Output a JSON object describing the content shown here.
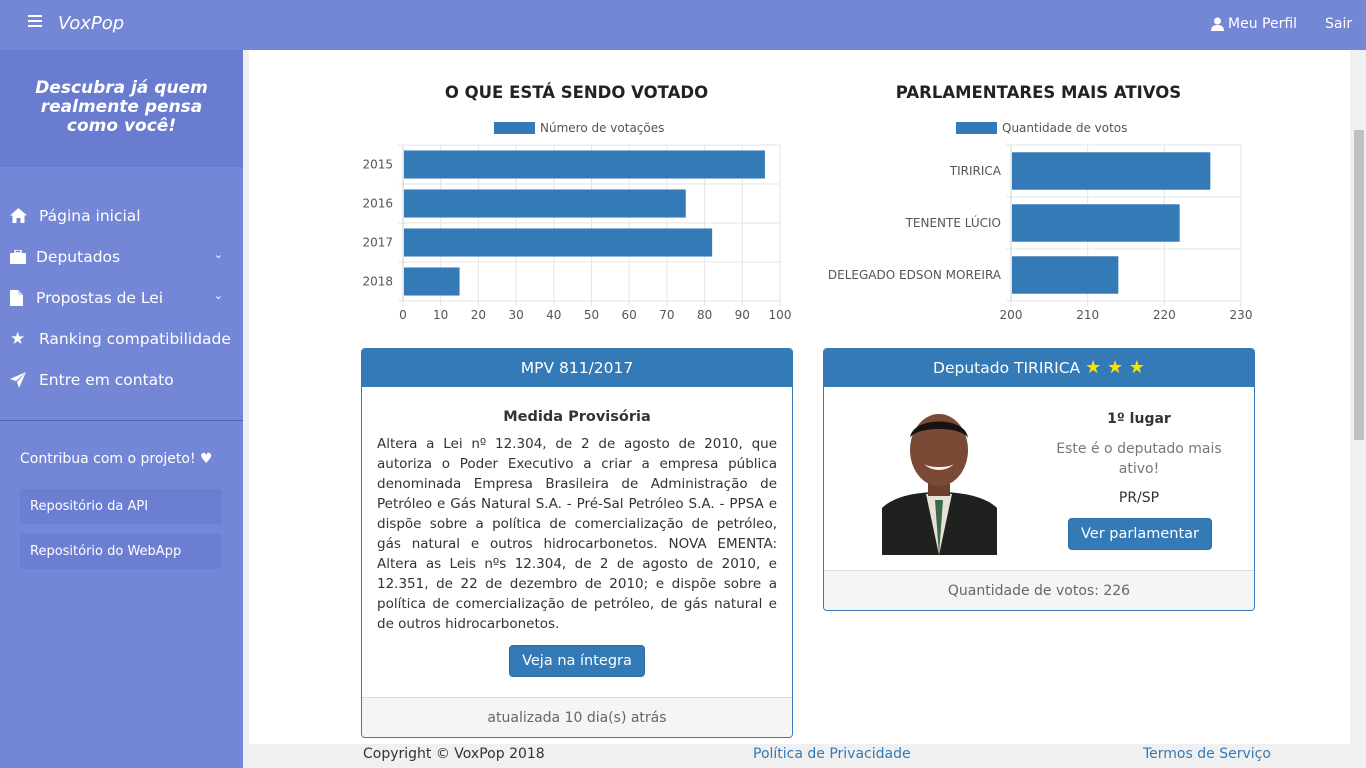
{
  "topbar": {
    "brand": "VoxPop",
    "profile_label": "Meu Perfil",
    "logout_label": "Sair"
  },
  "sidebar": {
    "tagline": "Descubra já quem realmente pensa como você!",
    "items": [
      {
        "label": "Página inicial",
        "icon": "home-icon"
      },
      {
        "label": "Deputados",
        "icon": "briefcase-icon"
      },
      {
        "label": "Propostas de Lei",
        "icon": "document-icon"
      },
      {
        "label": "Ranking compatibilidade",
        "icon": "star-icon"
      },
      {
        "label": "Entre em contato",
        "icon": "send-icon"
      }
    ],
    "contribute": "Contribua com o projeto! ♥",
    "buttons": [
      "Repositório da API",
      "Repositório do WebApp"
    ]
  },
  "charts": {
    "left_title": "O QUE ESTÁ SENDO VOTADO",
    "right_title": "PARLAMENTARES MAIS ATIVOS"
  },
  "chart_data": [
    {
      "type": "bar",
      "orientation": "horizontal",
      "title": "O QUE ESTÁ SENDO VOTADO",
      "categories": [
        "2015",
        "2016",
        "2017",
        "2018"
      ],
      "series": [
        {
          "name": "Número de votações",
          "values": [
            96,
            75,
            82,
            15
          ]
        }
      ],
      "xlim": [
        0,
        100
      ],
      "xticks": [
        "0",
        "10",
        "20",
        "30",
        "40",
        "50",
        "60",
        "70",
        "80",
        "90",
        "100"
      ],
      "grid": true,
      "legend": "top-center",
      "color": "#337ab7"
    },
    {
      "type": "bar",
      "orientation": "horizontal",
      "title": "PARLAMENTARES MAIS ATIVOS",
      "categories": [
        "TIRIRICA",
        "TENENTE LÚCIO",
        "DELEGADO EDSON MOREIRA"
      ],
      "series": [
        {
          "name": "Quantidade de votos",
          "values": [
            226,
            222,
            214
          ]
        }
      ],
      "xlim": [
        200,
        230
      ],
      "xticks": [
        "200",
        "210",
        "220",
        "230"
      ],
      "grid": true,
      "legend": "top-center",
      "color": "#337ab7"
    }
  ],
  "proposal_card": {
    "title": "MPV 811/2017",
    "subtitle": "Medida Provisória",
    "body": "Altera a Lei nº 12.304, de 2 de agosto de 2010, que autoriza o Poder Executivo a criar a empresa pública denominada Empresa Brasileira de Administração de Petróleo e Gás Natural S.A. - Pré-Sal Petróleo S.A. - PPSA e dispõe sobre a política de comercialização de petróleo, gás natural e outros hidrocarbonetos.  NOVA EMENTA: Altera as Leis nºs 12.304, de 2 de agosto de 2010, e 12.351, de 22 de dezembro de 2010; e dispõe sobre a política de comercialização de petróleo, de gás natural e de outros hidrocarbonetos.",
    "button": "Veja na íntegra",
    "footer": "atualizada 10 dia(s) atrás"
  },
  "deputy_card": {
    "title": "Deputado TIRIRICA",
    "stars": "★ ★ ★",
    "rank": "1º lugar",
    "description": "Este é o deputado mais ativo!",
    "state": "PR/SP",
    "button": "Ver parlamentar",
    "footer": "Quantidade de votos: 226"
  },
  "footer": {
    "copyright": "Copyright © VoxPop 2018",
    "privacy": "Política de Privacidade",
    "terms": "Termos de Serviço"
  }
}
